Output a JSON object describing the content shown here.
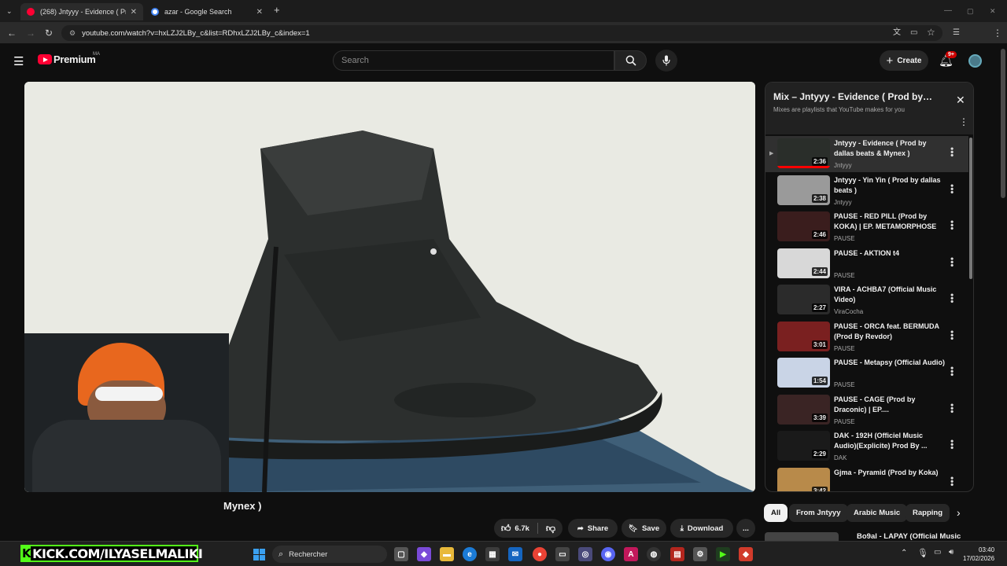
{
  "browser": {
    "tabs": [
      {
        "title": "(268) Jntyyy - Evidence ( Prod b",
        "favicon_color": "#ff0033",
        "active": true
      },
      {
        "title": "azar - Google Search",
        "favicon_color": "#4285f4",
        "active": false
      }
    ],
    "new_tab_label": "+",
    "url": "youtube.com/watch?v=hxLZJ2LBy_c&list=RDhxLZJ2LBy_c&index=1"
  },
  "youtube": {
    "logo_text": "Premium",
    "region": "MA",
    "search_placeholder": "Search",
    "create_label": "Create",
    "notif_count": "9+"
  },
  "video": {
    "title_fragment": "Mynex )",
    "likes": "6.7k",
    "share_label": "Share",
    "save_label": "Save",
    "download_label": "Download",
    "more_label": "..."
  },
  "playlist": {
    "title": "Mix – Jntyyy - Evidence ( Prod by…",
    "subtitle": "Mixes are playlists that YouTube makes for you",
    "items": [
      {
        "title": "Jntyyy - Evidence ( Prod by dallas beats & Mynex )",
        "channel": "Jntyyy",
        "duration": "2:36",
        "thumb": "#2a2e2a",
        "active": true
      },
      {
        "title": "Jntyyy - Yin Yin ( Prod by dallas beats )",
        "channel": "Jntyyy",
        "duration": "2:38",
        "thumb": "#9a9a9a",
        "active": false
      },
      {
        "title": "PAUSE - RED PILL (Prod by KOKA) | EP. METAMORPHOSE",
        "channel": "PAUSE",
        "duration": "2:46",
        "thumb": "#3a1d1d",
        "active": false
      },
      {
        "title": "PAUSE - AKTION t4",
        "channel": "PAUSE",
        "duration": "2:44",
        "thumb": "#d8d8d8",
        "active": false
      },
      {
        "title": "VIRA - ACHBA7 (Official Music Video)",
        "channel": "ViraCocha",
        "duration": "2:27",
        "thumb": "#2b2b2b",
        "active": false
      },
      {
        "title": "PAUSE - ORCA feat. BERMUDA (Prod By Revdor)",
        "channel": "PAUSE",
        "duration": "3:01",
        "thumb": "#7a2020",
        "active": false
      },
      {
        "title": "PAUSE - Metapsy (Official Audio)",
        "channel": "PAUSE",
        "duration": "1:54",
        "thumb": "#c9d4e6",
        "active": false
      },
      {
        "title": "PAUSE - CAGE (Prod by Draconic) | EP....",
        "channel": "PAUSE",
        "duration": "3:39",
        "thumb": "#3a2424",
        "active": false
      },
      {
        "title": "DAK - 192H (Officiel Music Audio)(Explicite) Prod By ...",
        "channel": "DAK",
        "duration": "2:29",
        "thumb": "#1a1a1a",
        "active": false
      },
      {
        "title": "Gjma - Pyramid (Prod by Koka)",
        "channel": "GJMA",
        "duration": "3:42",
        "thumb": "#b88a4a",
        "active": false
      }
    ]
  },
  "chips": [
    "All",
    "From Jntyyy",
    "Arabic Music",
    "Rapping"
  ],
  "next_video": {
    "title": "Bo9al - LAPAY (Official Music"
  },
  "taskbar": {
    "search_label": "Rechercher",
    "time": "03:40",
    "date": "17/02/2026"
  },
  "stream_overlay": {
    "kick_text": "KICK.COM/ILYASELMALIKI"
  }
}
